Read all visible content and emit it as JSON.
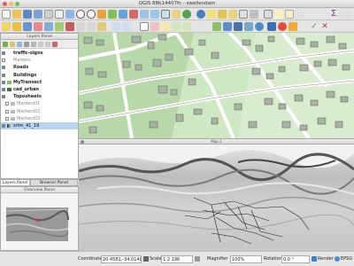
{
  "window": {
    "title": "QGIS 88b14407fc - swellendam"
  },
  "layers_panel": {
    "title": "Layers Panel",
    "layers": [
      {
        "label": "traffic-signs",
        "checked": true,
        "style": "bold",
        "symbol": "none"
      },
      {
        "label": "Markers",
        "checked": false,
        "style": "grey",
        "symbol": "none"
      },
      {
        "label": "Roads",
        "checked": true,
        "style": "bold",
        "symbol": "none"
      },
      {
        "label": "Buildings",
        "checked": true,
        "style": "bold",
        "symbol": "none"
      },
      {
        "label": "MyTransect",
        "checked": true,
        "style": "bold",
        "symbol": "green"
      },
      {
        "label": "cad_urban",
        "checked": true,
        "style": "bold",
        "symbol": "darkgreen"
      },
      {
        "label": "Toposheets",
        "checked": true,
        "style": "bold",
        "symbol": "none"
      },
      {
        "label": "Markers01",
        "checked": false,
        "style": "grey",
        "symbol": "grey"
      },
      {
        "label": "Markers02",
        "checked": false,
        "style": "grey",
        "symbol": "grey"
      },
      {
        "label": "Markers03",
        "checked": false,
        "style": "grey",
        "symbol": "grey"
      },
      {
        "label": "srtm_41_19",
        "checked": true,
        "style": "selected",
        "symbol": "raster"
      }
    ]
  },
  "tabs": {
    "layers": "Layers Panel",
    "browser": "Browser Panel"
  },
  "overview_panel": {
    "title": "Overview Panel"
  },
  "map2": {
    "title": "Map 1"
  },
  "statusbar": {
    "coordinate_label": "Coordinate",
    "coordinate_value": "20.4581,-34.0148",
    "scale_label": "Scale",
    "scale_value": "1:2 196",
    "magnifier_label": "Magnifier",
    "magnifier_value": "100%",
    "rotation_label": "Rotation",
    "rotation_value": "0,0 °",
    "render_label": "Render",
    "crs_label": "EPSG"
  },
  "colors": {
    "map_green": "#cfe8c4",
    "map_road": "#ffffff",
    "building_fill": "#a9b3a3",
    "selection_blue": "#b8d4f0"
  }
}
